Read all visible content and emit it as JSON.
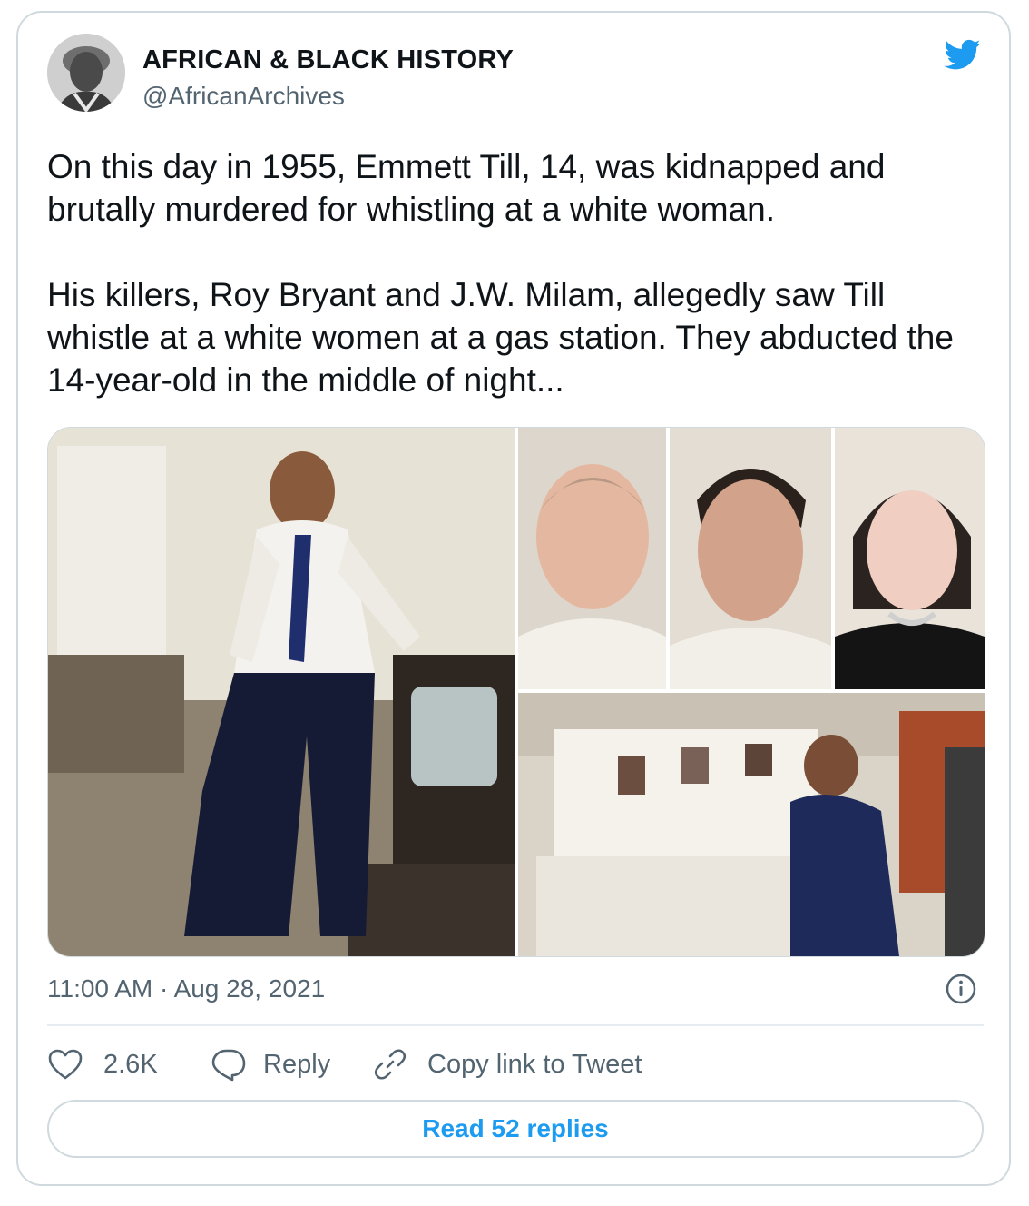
{
  "author": {
    "name": "AFRICAN & BLACK HISTORY",
    "handle": "@AfricanArchives"
  },
  "tweet": {
    "paragraphs": [
      "On this day in 1955, Emmett Till, 14, was kidnapped and brutally murdered for whistling at a white woman.",
      "His killers, Roy Bryant and J.W. Milam, allegedly saw Till whistle at a white women at a gas station. They abducted the 14-year-old in the middle of night..."
    ],
    "timestamp": "11:00 AM · Aug 28, 2021"
  },
  "actions": {
    "likes": "2.6K",
    "reply_label": "Reply",
    "copy_link_label": "Copy link to Tweet"
  },
  "read_replies_label": "Read 52 replies",
  "icons": [
    "twitter-bird-icon",
    "info-icon",
    "heart-icon",
    "reply-icon",
    "link-icon"
  ],
  "colors": {
    "brand": "#1d9bf0",
    "text": "#0f1419",
    "muted": "#536471",
    "border": "#cfd9de"
  }
}
